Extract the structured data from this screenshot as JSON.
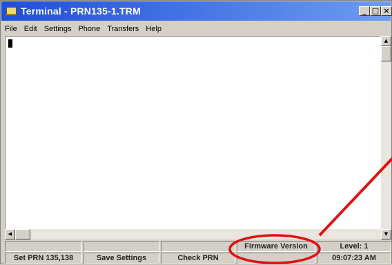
{
  "window": {
    "title": "Terminal - PRN135-1.TRM",
    "controls": {
      "minimize": "_",
      "maximize": "□",
      "close": "×"
    }
  },
  "menu": {
    "file": "File",
    "edit": "Edit",
    "settings": "Settings",
    "phone": "Phone",
    "transfers": "Transfers",
    "help": "Help"
  },
  "scrollbars": {
    "up_arrow": "▲",
    "down_arrow": "▼",
    "left_arrow": "◀"
  },
  "status": {
    "row1": [
      "",
      "",
      "",
      "Firmware Version",
      "Level: 1"
    ],
    "row2": [
      "Set PRN 135,138",
      "Save Settings",
      "Check PRN",
      "",
      "09:07:23 AM"
    ]
  },
  "annotation": {
    "color": "#e01010"
  }
}
